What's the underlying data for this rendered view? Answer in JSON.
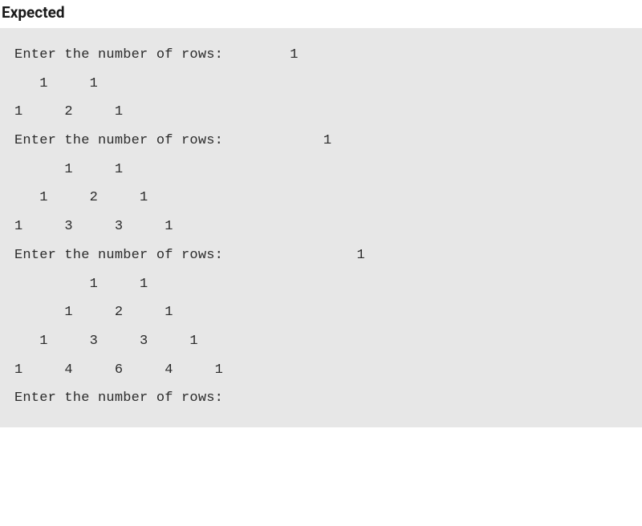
{
  "heading": "Expected",
  "lines": [
    "Enter the number of rows:        1",
    "   1     1",
    "1     2     1",
    "Enter the number of rows:            1",
    "      1     1",
    "   1     2     1",
    "1     3     3     1",
    "Enter the number of rows:                1",
    "         1     1",
    "      1     2     1",
    "   1     3     3     1",
    "1     4     6     4     1",
    "Enter the number of rows: "
  ]
}
